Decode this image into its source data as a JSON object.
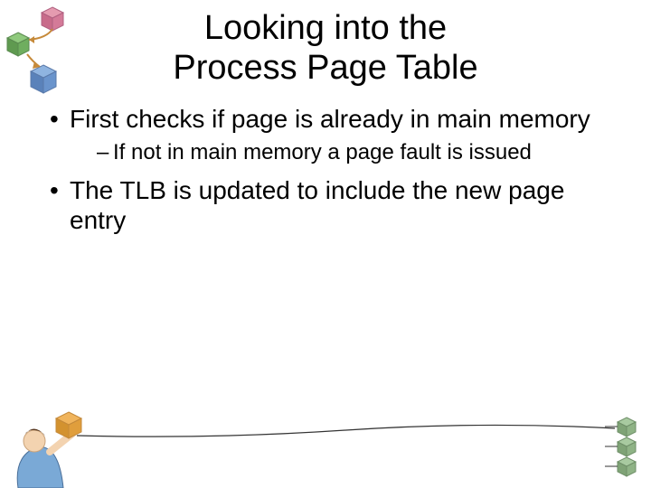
{
  "title_line1": "Looking into the",
  "title_line2": "Process Page Table",
  "bullets": [
    {
      "text": "First checks if page is already in main memory",
      "sub": [
        "If not in main memory a page fault is issued"
      ]
    },
    {
      "text": "The TLB is updated to include the new page entry",
      "sub": []
    }
  ]
}
